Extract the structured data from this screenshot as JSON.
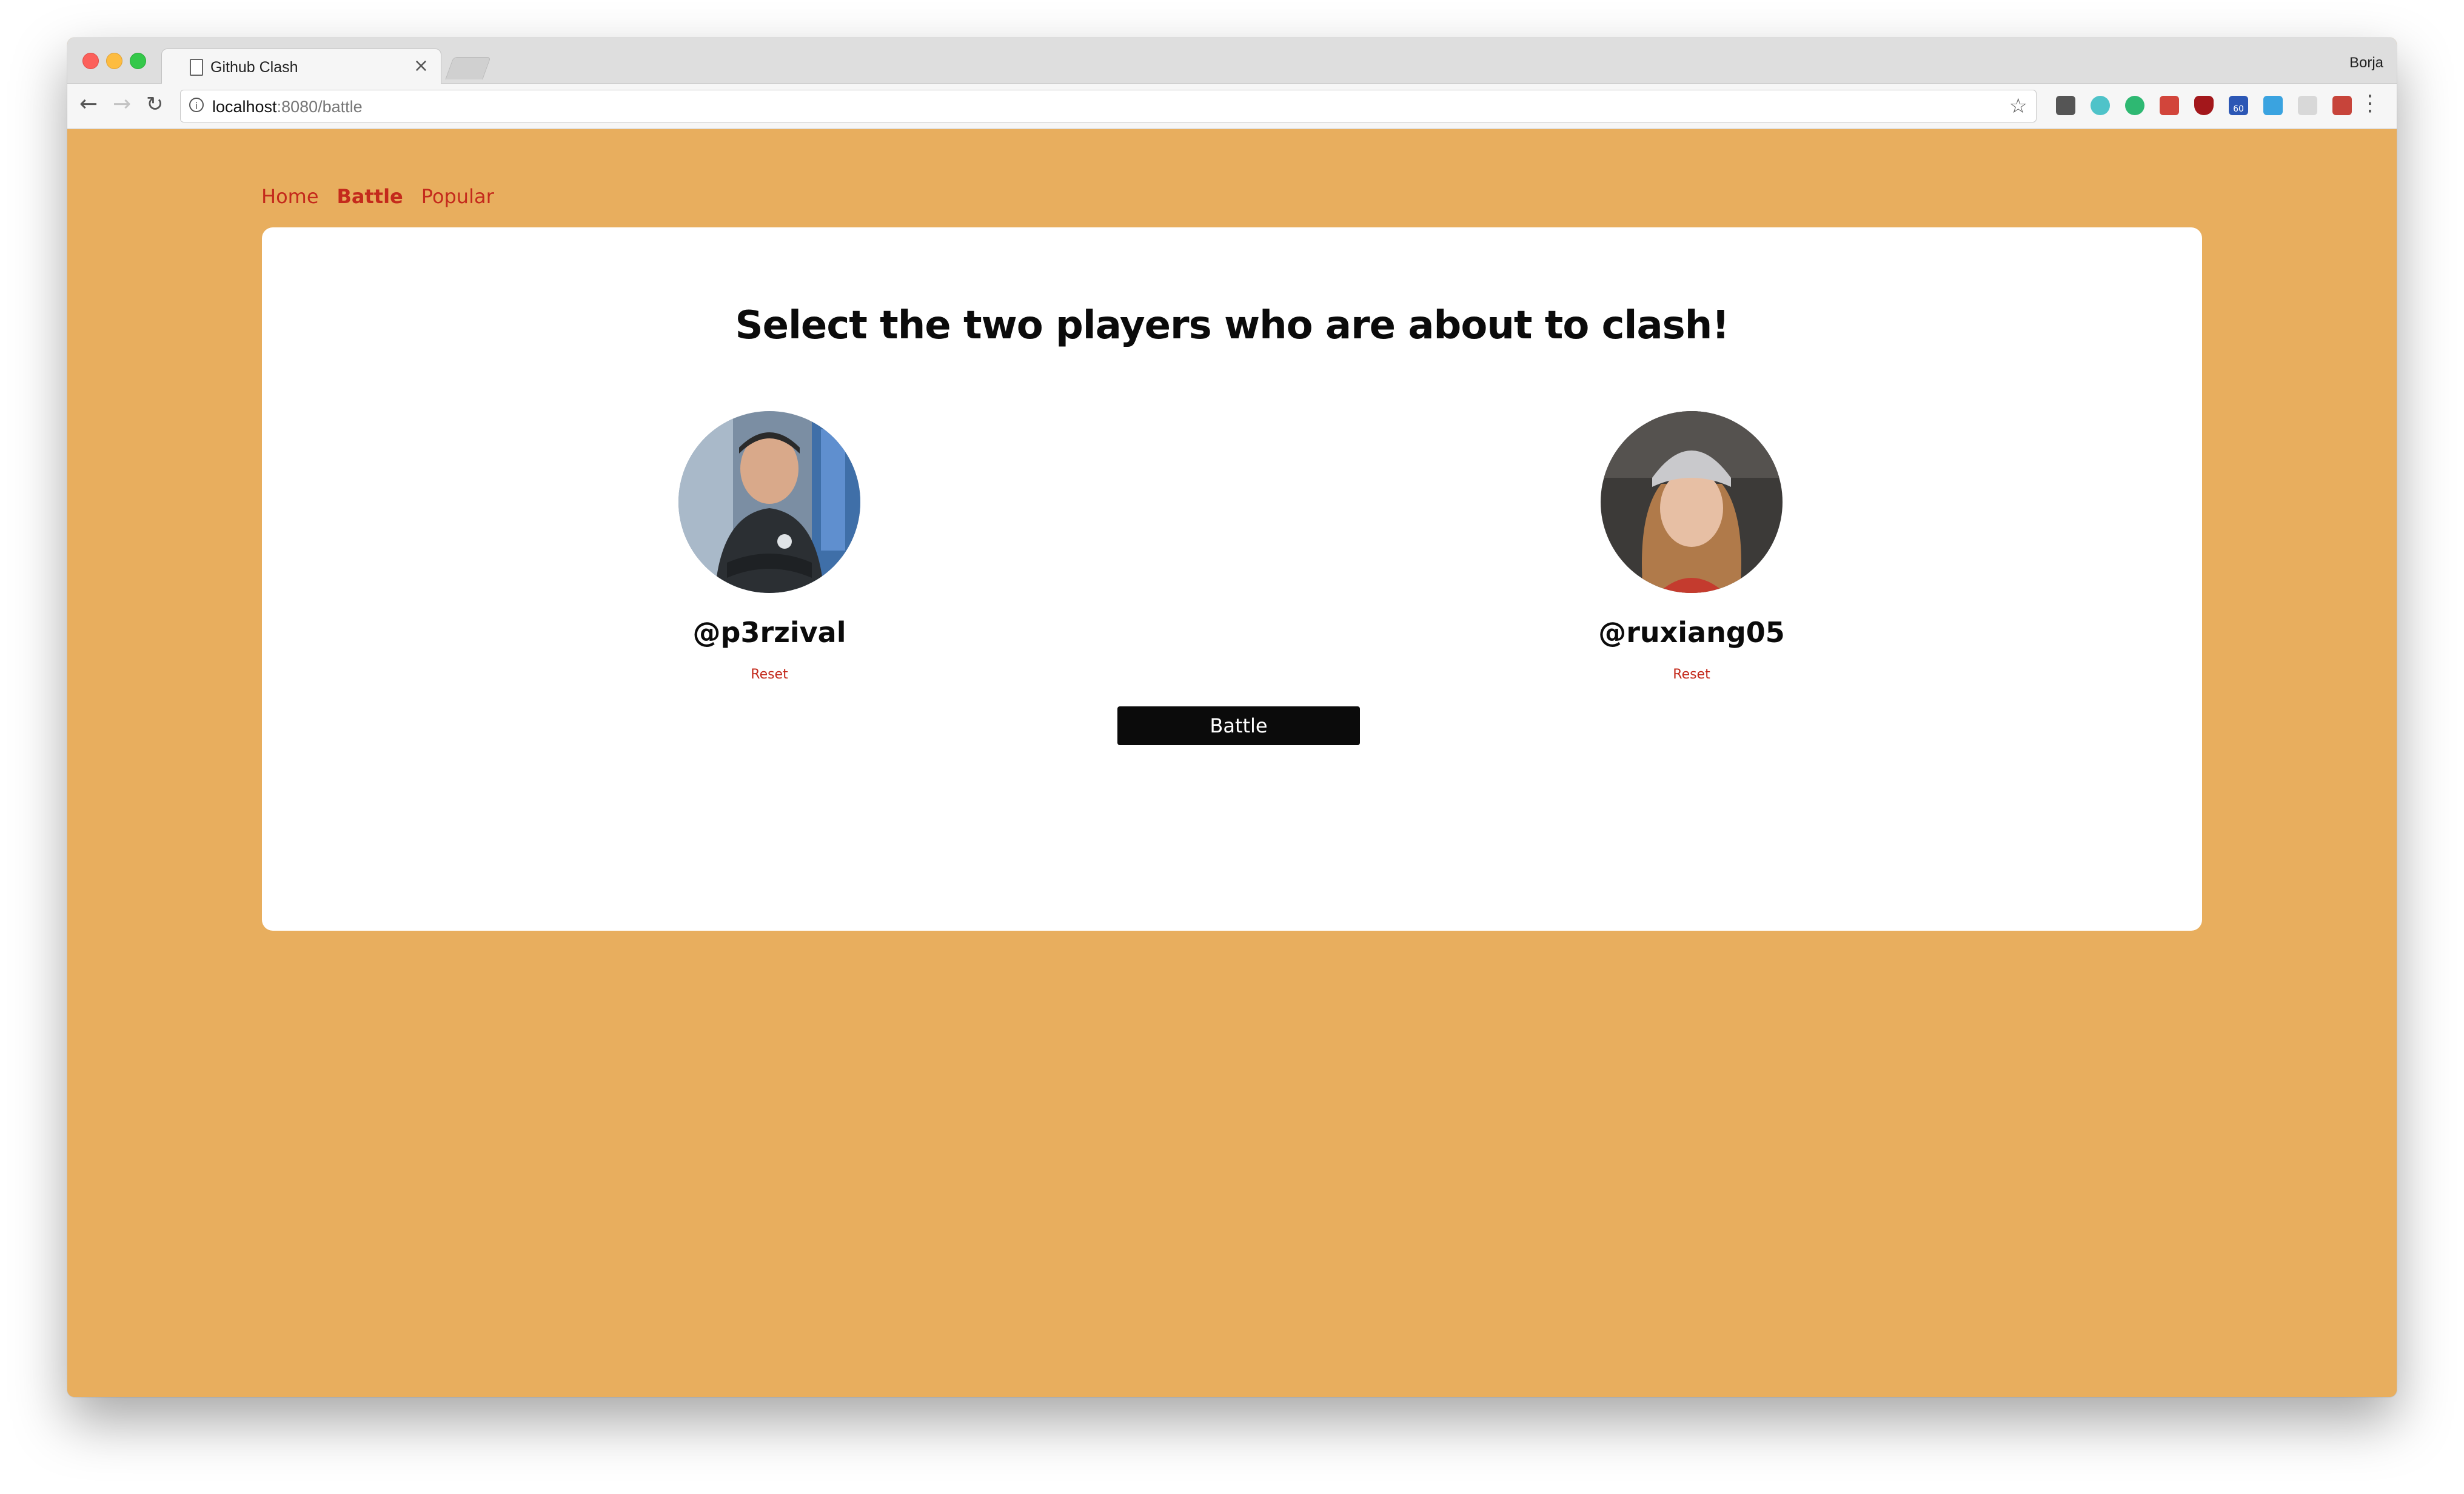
{
  "browser": {
    "tab_title": "Github Clash",
    "profile_name": "Borja",
    "url_host": "localhost",
    "url_path": ":8080/battle",
    "extension_badge": "60"
  },
  "nav": {
    "links": [
      {
        "label": "Home",
        "active": false
      },
      {
        "label": "Battle",
        "active": true
      },
      {
        "label": "Popular",
        "active": false
      }
    ]
  },
  "battle": {
    "headline": "Select the two players who are about to clash!",
    "players": [
      {
        "handle": "@p3rzival",
        "reset_label": "Reset"
      },
      {
        "handle": "@ruxiang05",
        "reset_label": "Reset"
      }
    ],
    "battle_button_label": "Battle"
  },
  "colors": {
    "page_background": "#e8ae5e",
    "link_red": "#c42a1c",
    "button_black": "#0b0b0b"
  }
}
